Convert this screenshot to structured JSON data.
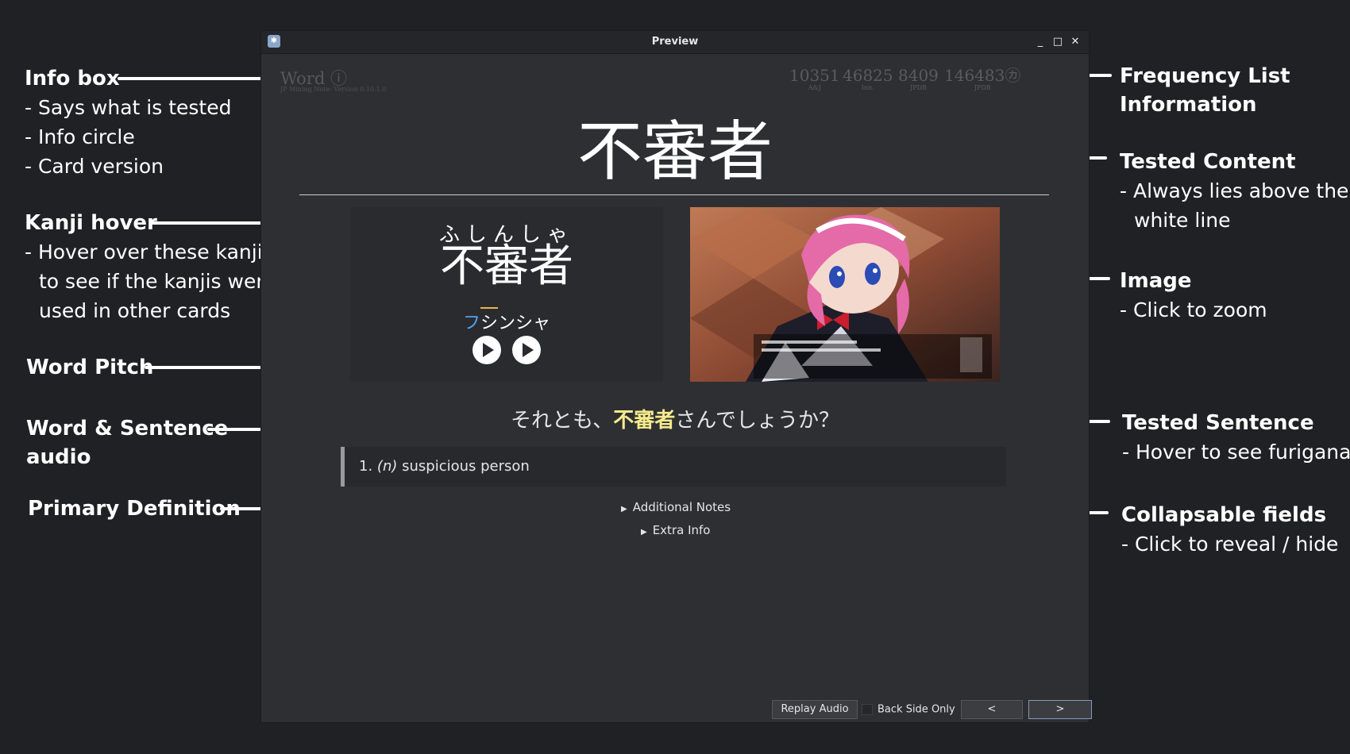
{
  "annotations": {
    "info_box": {
      "title": "Info box",
      "lines": [
        "- Says what is tested",
        "- Info circle",
        "- Card version"
      ]
    },
    "kanji_hover": {
      "title": "Kanji hover",
      "lines": [
        "- Hover over these kanjis",
        "to see if the kanjis were",
        "used in other cards"
      ]
    },
    "word_pitch": {
      "title": "Word Pitch"
    },
    "audio": {
      "title_line1": "Word & Sentence",
      "title_line2": "audio"
    },
    "primary_definition": {
      "title": "Primary Definition"
    },
    "frequency": {
      "title_line1": "Frequency List",
      "title_line2": "Information"
    },
    "tested_content": {
      "title": "Tested Content",
      "lines": [
        "- Always lies above the",
        "white line"
      ]
    },
    "image": {
      "title": "Image",
      "lines": [
        "- Click to zoom"
      ]
    },
    "tested_sentence": {
      "title": "Tested Sentence",
      "lines": [
        "- Hover to see furigana"
      ]
    },
    "collapsable": {
      "title": "Collapsable fields",
      "lines": [
        "- Click to reveal / hide"
      ]
    }
  },
  "window": {
    "title": "Preview",
    "buttons": {
      "minimize": "_",
      "maximize": "□",
      "close": "✕"
    }
  },
  "card": {
    "info_word": "Word ⓘ",
    "info_version": "JP Mining Note: Version 0.10.1.0",
    "frequencies": [
      {
        "value": "10351",
        "source": "A&J"
      },
      {
        "value": "46825",
        "source": "Inn."
      },
      {
        "value": "8409",
        "source": "JPDB"
      },
      {
        "value": "146483㋕",
        "source": "JPDB"
      }
    ],
    "tested_word": "不審者",
    "reading": "ふしんしゃ",
    "kanji_word": "不審者",
    "pitch": {
      "part1": "フ",
      "part2": "シ",
      "part3": "ンシャ"
    },
    "sentence": {
      "before": "それとも、",
      "highlight": "不審者",
      "after": "さんでしょうか？"
    },
    "definition": {
      "number": "1.",
      "pos": "(n)",
      "text": "suspicious person"
    },
    "collapsible": [
      "Additional Notes",
      "Extra Info"
    ]
  },
  "bottom_bar": {
    "replay": "Replay Audio",
    "back_only": "Back Side Only",
    "prev": "<",
    "next": ">"
  },
  "colors": {
    "background": "#202124",
    "window": "#2e2f33",
    "sentence_highlight": "#f5eb8c",
    "pitch_high": "#4fa3f0",
    "pitch_accent": "#e8b64a",
    "next_button_border": "#7f9bbd"
  }
}
